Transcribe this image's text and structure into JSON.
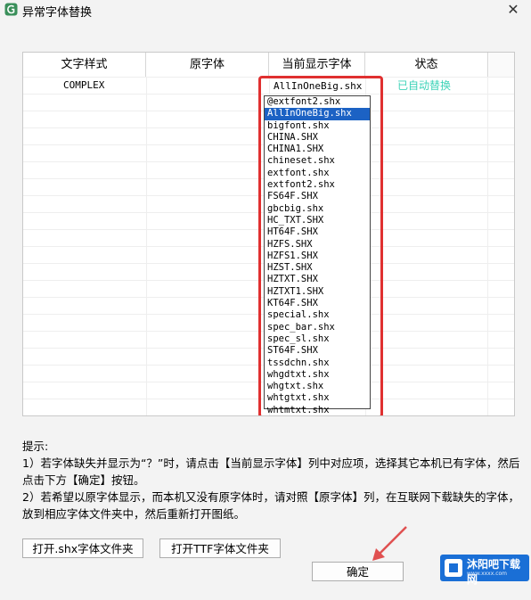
{
  "window": {
    "title": "异常字体替换",
    "close_glyph": "✕"
  },
  "table": {
    "headers": [
      "文字样式",
      "原字体",
      "当前显示字体",
      "状态"
    ],
    "rows": [
      {
        "style": "COMPLEX",
        "original": "",
        "current": "AllInOneBig.shx",
        "status": "已自动替换"
      }
    ]
  },
  "dropdown": {
    "selected": "AllInOneBig.shx",
    "options": [
      "@extfont2.shx",
      "AllInOneBig.shx",
      "bigfont.shx",
      "CHINA.SHX",
      "CHINA1.SHX",
      "chineset.shx",
      "extfont.shx",
      "extfont2.shx",
      "FS64F.SHX",
      "gbcbig.shx",
      "HC_TXT.SHX",
      "HT64F.SHX",
      "HZFS.SHX",
      "HZFS1.SHX",
      "HZST.SHX",
      "HZTXT.SHX",
      "HZTXT1.SHX",
      "KT64F.SHX",
      "special.shx",
      "spec_bar.shx",
      "spec_sl.shx",
      "ST64F.SHX",
      "tssdchn.shx",
      "whgdtxt.shx",
      "whgtxt.shx",
      "whtgtxt.shx",
      "whtmtxt.shx"
    ]
  },
  "hints": {
    "title": "提示:",
    "line1": "1）若字体缺失并显示为“？”时，请点击【当前显示字体】列中对应项，选择其它本机已有字体，然后点击下方【确定】按钮。",
    "line2": "2）若希望以原字体显示，而本机又没有原字体时，请对照【原字体】列，在互联网下载缺失的字体，放到相应字体文件夹中，然后重新打开图纸。"
  },
  "buttons": {
    "open_shx": "打开.shx字体文件夹",
    "open_ttf": "打开TTF字体文件夹",
    "ok": "确定"
  },
  "watermark": {
    "text": "沐阳吧下载网",
    "sub": "www.xxxx.com"
  },
  "colors": {
    "status": "#3ed3b8",
    "highlight": "#e03030",
    "selection": "#1c62c4",
    "arrow": "#e05050"
  }
}
